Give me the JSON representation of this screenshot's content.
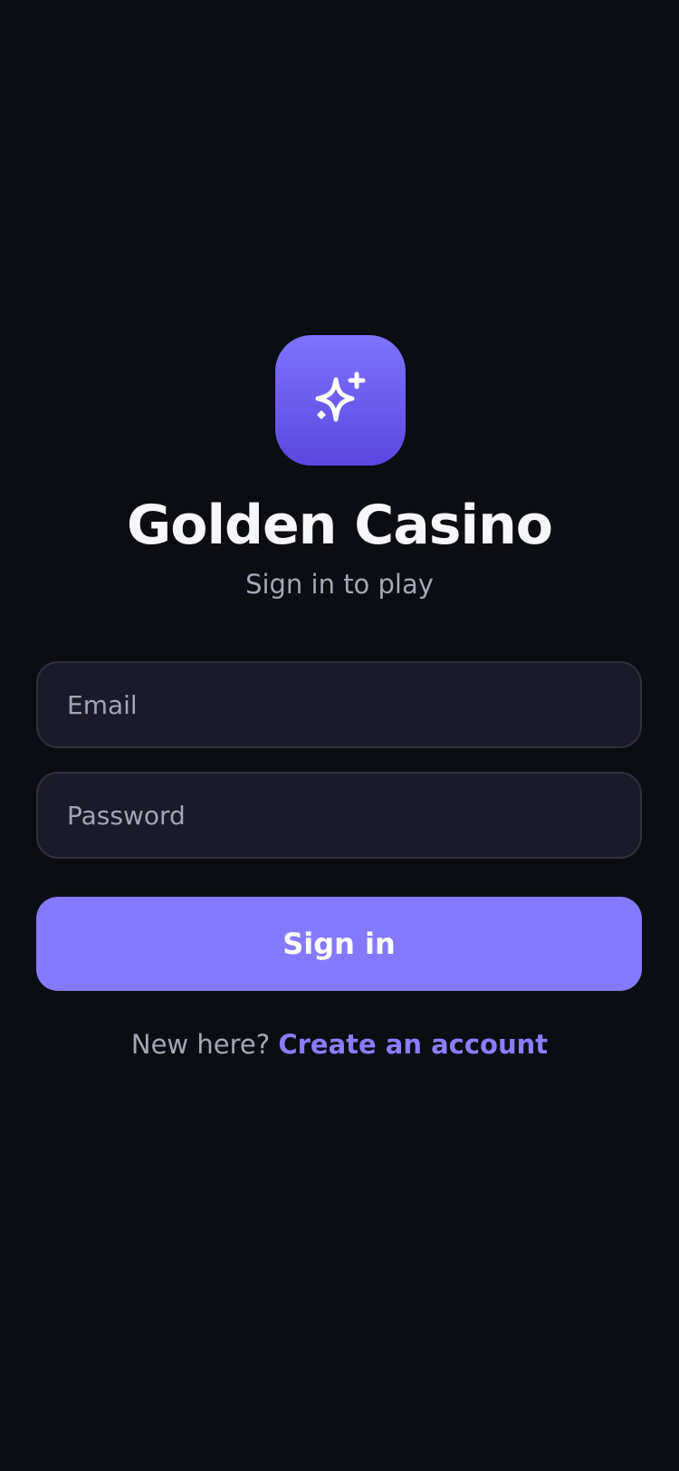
{
  "app": {
    "title": "Golden Casino",
    "subtitle": "Sign in to play",
    "logo_icon": "sparkles-icon"
  },
  "form": {
    "email": {
      "value": "",
      "placeholder": "Email"
    },
    "password": {
      "value": "",
      "placeholder": "Password"
    },
    "submit_label": "Sign in"
  },
  "footer": {
    "prompt": "New here?",
    "link_label": "Create an account"
  },
  "colors": {
    "background": "#0c0d12",
    "accent": "#8579ff",
    "link": "#8a7dff",
    "field_bg": "#1b1a28"
  }
}
